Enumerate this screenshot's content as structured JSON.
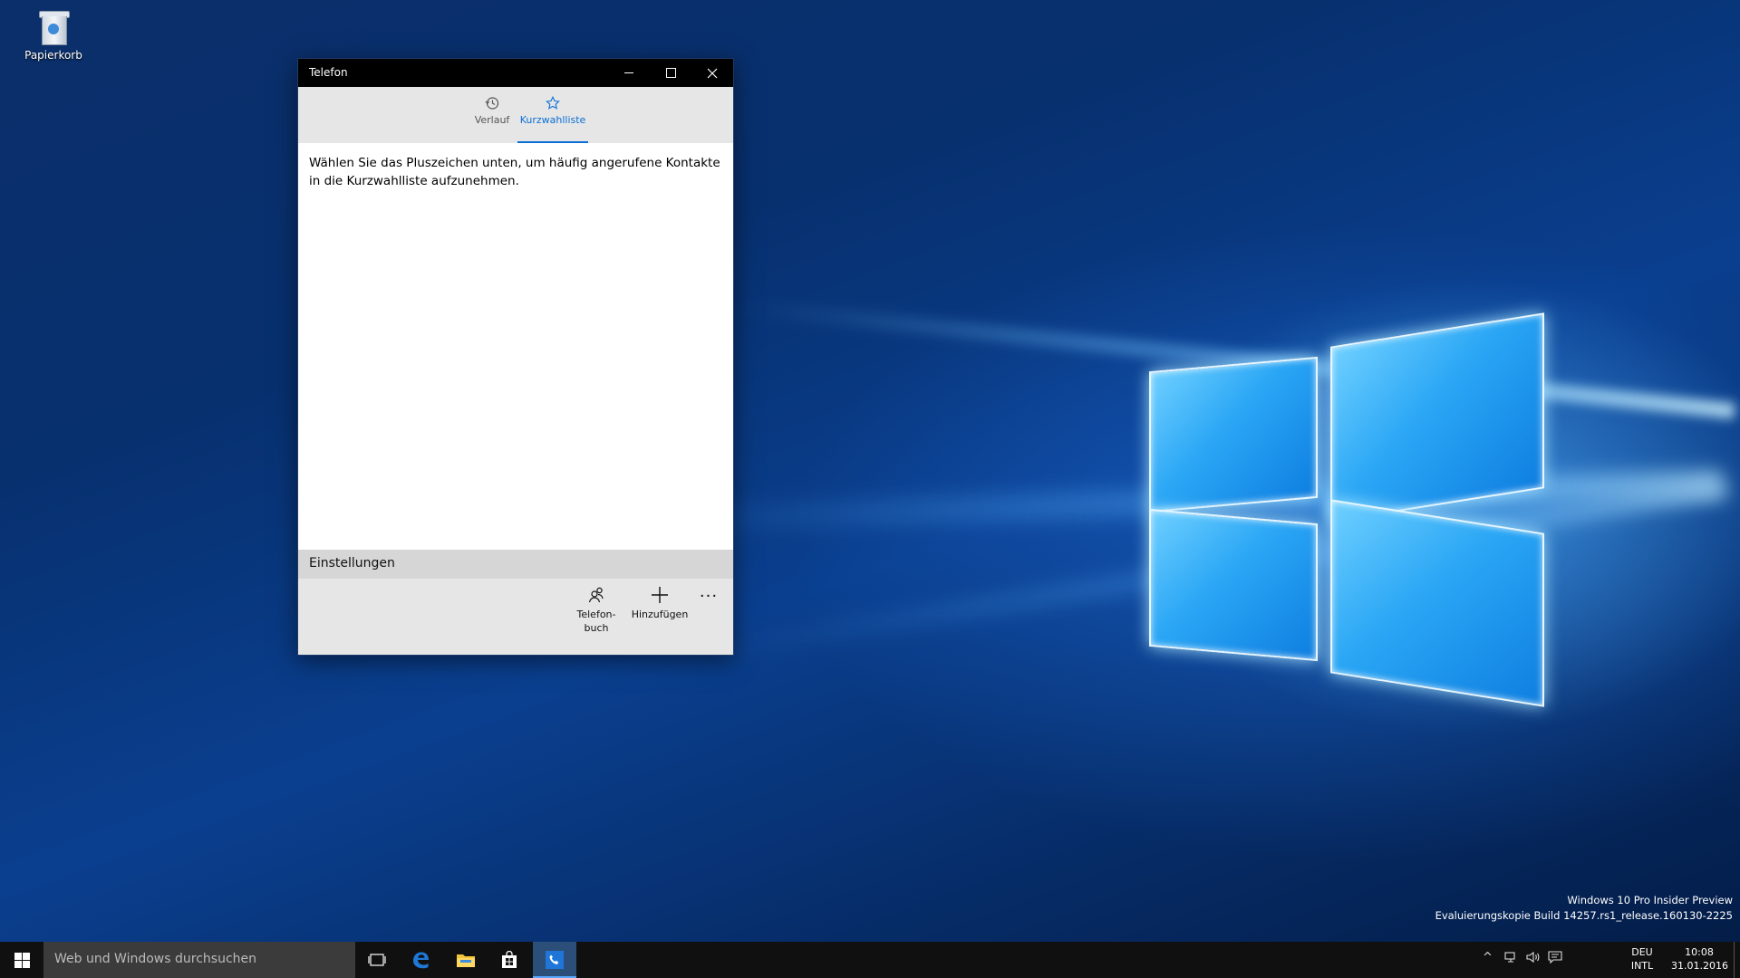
{
  "desktop": {
    "recycle_bin_label": "Papierkorb"
  },
  "app": {
    "title": "Telefon",
    "tabs": [
      {
        "label": "Verlauf",
        "icon": "history-icon"
      },
      {
        "label": "Kurzwahlliste",
        "icon": "star-icon"
      }
    ],
    "active_tab": "Kurzwahlliste",
    "info_text": "Wählen Sie das Pluszeichen unten, um häufig angerufene Kontakte in die Kurzwahlliste aufzunehmen.",
    "settings_label": "Einstellungen",
    "commands": [
      {
        "label": "Telefon-\nbuch",
        "line1": "Telefon-",
        "line2": "buch",
        "icon": "contacts-icon"
      },
      {
        "label": "Hinzufügen",
        "icon": "plus-icon"
      },
      {
        "label": "···",
        "icon": "more-icon"
      }
    ]
  },
  "watermark": {
    "line1": "Windows 10 Pro Insider Preview",
    "line2": "Evaluierungskopie Build 14257.rs1_release.160130-2225"
  },
  "taskbar": {
    "search_placeholder": "Web und Windows durchsuchen",
    "pinned": [
      "task-view-icon",
      "edge-icon",
      "file-explorer-icon",
      "store-icon",
      "phone-icon"
    ],
    "language_line1": "DEU",
    "language_line2": "INTL",
    "time": "10:08",
    "date": "31.01.2016"
  },
  "colors": {
    "accent": "#0a6fd6",
    "titlebar": "#000000",
    "taskbar": "#101010"
  }
}
